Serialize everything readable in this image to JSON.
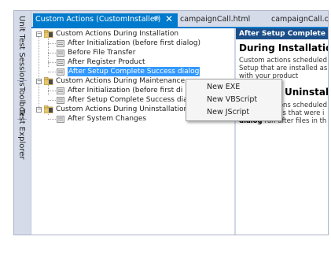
{
  "dock": {
    "tabs": [
      "Unit Test Sessions",
      "Toolbox",
      "Test Explorer"
    ]
  },
  "tabs": {
    "active": {
      "label": "Custom Actions (CustomInstaller)",
      "pin": "⊕",
      "close": "✕"
    },
    "inactive": [
      {
        "label": "campaignCall.html"
      },
      {
        "label": "campaignCall.c"
      }
    ]
  },
  "tree": {
    "groups": [
      {
        "label": "Custom Actions During Installation",
        "expander": "−",
        "items": [
          {
            "label": "After Initialization (before first dialog)"
          },
          {
            "label": "Before File Transfer"
          },
          {
            "label": "After Register Product"
          },
          {
            "label": "After Setup Complete Success dialog",
            "selected": true
          }
        ]
      },
      {
        "label": "Custom Actions During Maintenance",
        "expander": "−",
        "items": [
          {
            "label": "After Initialization (before first di"
          },
          {
            "label": "After Setup Complete Success dia"
          }
        ]
      },
      {
        "label": "Custom Actions During Uninstallation",
        "expander": "−",
        "items": [
          {
            "label": "After System Changes"
          }
        ]
      }
    ]
  },
  "help": {
    "title": "After Setup Complete S",
    "heading1": "During Installation",
    "para1": [
      "Custom actions scheduled",
      "Setup that are installed as p",
      "with your product"
    ],
    "heading2": "Uninstallati",
    "para2_line1": "Custom actions scheduled",
    "para2_line2": "access to files that were i",
    "para2_line3_bold": "dialog",
    "para2_line3_rest": " run after files in th"
  },
  "context_menu": {
    "items": [
      "New EXE",
      "New VBScript",
      "New JScript"
    ]
  },
  "colors": {
    "accent": "#007acc",
    "selection": "#3399ff",
    "help_title_bg": "#1c4f8a"
  }
}
